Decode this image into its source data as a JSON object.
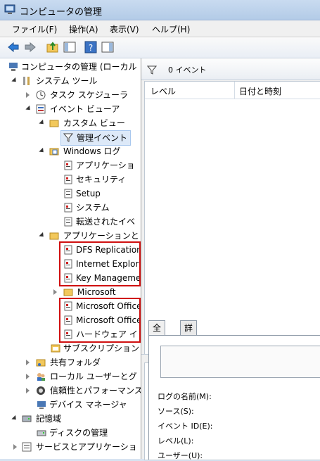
{
  "window": {
    "title": "コンピュータの管理"
  },
  "menu": [
    "ファイル(F)",
    "操作(A)",
    "表示(V)",
    "ヘルプ(H)"
  ],
  "tree": [
    {
      "label": "コンピュータの管理 (ローカル"
    },
    {
      "label": "システム ツール"
    },
    {
      "label": "タスク スケジューラ"
    },
    {
      "label": "イベント ビューア"
    },
    {
      "label": "カスタム ビュー"
    },
    {
      "label": "管理イベント"
    },
    {
      "label": "Windows ログ"
    },
    {
      "label": "アプリケーショ"
    },
    {
      "label": "セキュリティ"
    },
    {
      "label": "Setup"
    },
    {
      "label": "システム"
    },
    {
      "label": "転送されたイベ"
    },
    {
      "label": "アプリケーションと"
    },
    {
      "label": "DFS Replication"
    },
    {
      "label": "Internet Explor"
    },
    {
      "label": "Key Manageme"
    },
    {
      "label": "Microsoft"
    },
    {
      "label": "Microsoft Office"
    },
    {
      "label": "Microsoft Office"
    },
    {
      "label": "ハードウェア イ"
    },
    {
      "label": "サブスクリプション"
    },
    {
      "label": "共有フォルダ"
    },
    {
      "label": "ローカル ユーザーとグ"
    },
    {
      "label": "信頼性とパフォーマンス"
    },
    {
      "label": "デバイス マネージャ"
    },
    {
      "label": "記憶域"
    },
    {
      "label": "ディスクの管理"
    },
    {
      "label": "サービスとアプリケーショ"
    }
  ],
  "events": {
    "count_label": "0 イベント",
    "col_level": "レベル",
    "col_datetime": "日付と時刻"
  },
  "details": {
    "tab_general": "全般",
    "tab_detail": "詳細",
    "fields": [
      "ログの名前(M):",
      "ソース(S):",
      "イベント ID(E):",
      "レベル(L):",
      "ユーザー(U):"
    ]
  }
}
